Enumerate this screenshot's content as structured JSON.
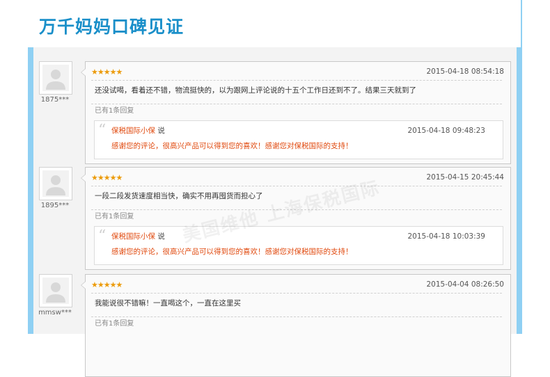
{
  "section_title": "万千妈妈口碑见证",
  "watermark": "美国维他 上海保税国际",
  "reviews": [
    {
      "user": "1875***",
      "stars": "★★★★★",
      "date": "2015-04-18 08:54:18",
      "content": "还没试喝，看着还不错，物流挺快的，以为跟网上评论说的十五个工作日还到不了。结果三天就到了",
      "reply_count_text": "已有1条回复",
      "reply": {
        "author": "保税国际小保",
        "verb": "说",
        "date": "2015-04-18 09:48:23",
        "text": "感谢您的评论，很高兴产品可以得到您的喜欢！感谢您对保税国际的支持！"
      }
    },
    {
      "user": "1895***",
      "stars": "★★★★★",
      "date": "2015-04-15 20:45:44",
      "content": "一段二段发货速度相当快，确实不用再囤货而担心了",
      "reply_count_text": "已有1条回复",
      "reply": {
        "author": "保税国际小保",
        "verb": "说",
        "date": "2015-04-18 10:03:39",
        "text": "感谢您的评论，很高兴产品可以得到您的喜欢！感谢您对保税国际的支持！"
      }
    },
    {
      "user": "mmsw***",
      "stars": "★★★★★",
      "date": "2015-04-04 08:26:50",
      "content": "我能说很不错嘛！一直喝这个，一直在这里买",
      "reply_count_text": "已有1条回复"
    }
  ],
  "colors": {
    "title": "#1a8fc9",
    "side_bar": "#8fd0f3",
    "stars": "#ec9b0b",
    "reply_text": "#e0490e"
  },
  "icons": {
    "avatar": "default-user-avatar-icon",
    "quote": "quote-mark-icon",
    "star": "star-icon"
  }
}
